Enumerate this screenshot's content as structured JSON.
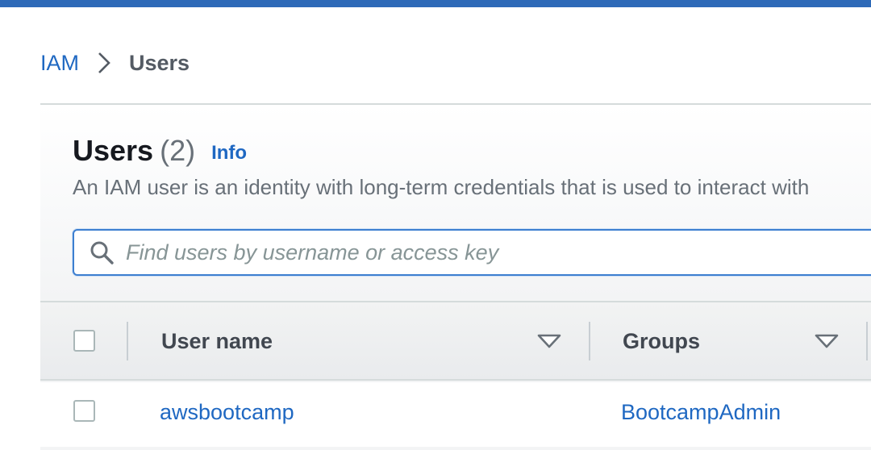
{
  "breadcrumb": {
    "root": "IAM",
    "current": "Users"
  },
  "panel": {
    "title": "Users",
    "count": "(2)",
    "info": "Info",
    "description": "An IAM user is an identity with long-term credentials that is used to interact with"
  },
  "search": {
    "placeholder": "Find users by username or access key",
    "value": ""
  },
  "table": {
    "columns": [
      "User name",
      "Groups"
    ],
    "rows": [
      {
        "user_name": "awsbootcamp",
        "groups": "BootcampAdmin"
      }
    ]
  },
  "colors": {
    "accent": "#1f68c2",
    "topbar": "#2e6ab8",
    "search_border": "#3d7fd0"
  },
  "icons": {
    "breadcrumb_separator": "chevron-right-icon",
    "search": "search-icon",
    "sort": "caret-down-icon"
  }
}
